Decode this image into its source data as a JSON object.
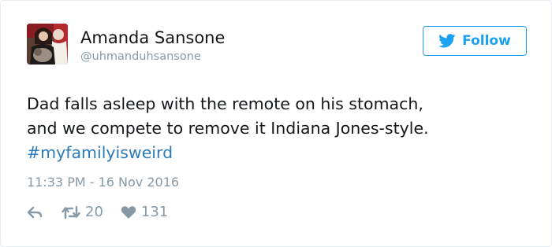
{
  "tweet": {
    "author_name": "Amanda Sansone",
    "author_handle": "@uhmanduhsansone",
    "follow_label": "Follow",
    "text_line1": "Dad falls asleep with the remote on his stomach,",
    "text_line2": "and we compete to remove it Indiana Jones-style.",
    "hashtag": "#myfamilyisweird",
    "timestamp": "11:33 PM - 16 Nov 2016",
    "retweet_count": "20",
    "like_count": "131"
  },
  "icons": {
    "follow": "twitter-bird-icon",
    "reply": "reply-icon",
    "retweet": "retweet-icon",
    "like": "heart-icon"
  },
  "colors": {
    "accent": "#1da1f2",
    "hashtag": "#2b7bb9",
    "muted": "#8899a6",
    "text": "#14171a",
    "border": "#e6ecf0"
  }
}
